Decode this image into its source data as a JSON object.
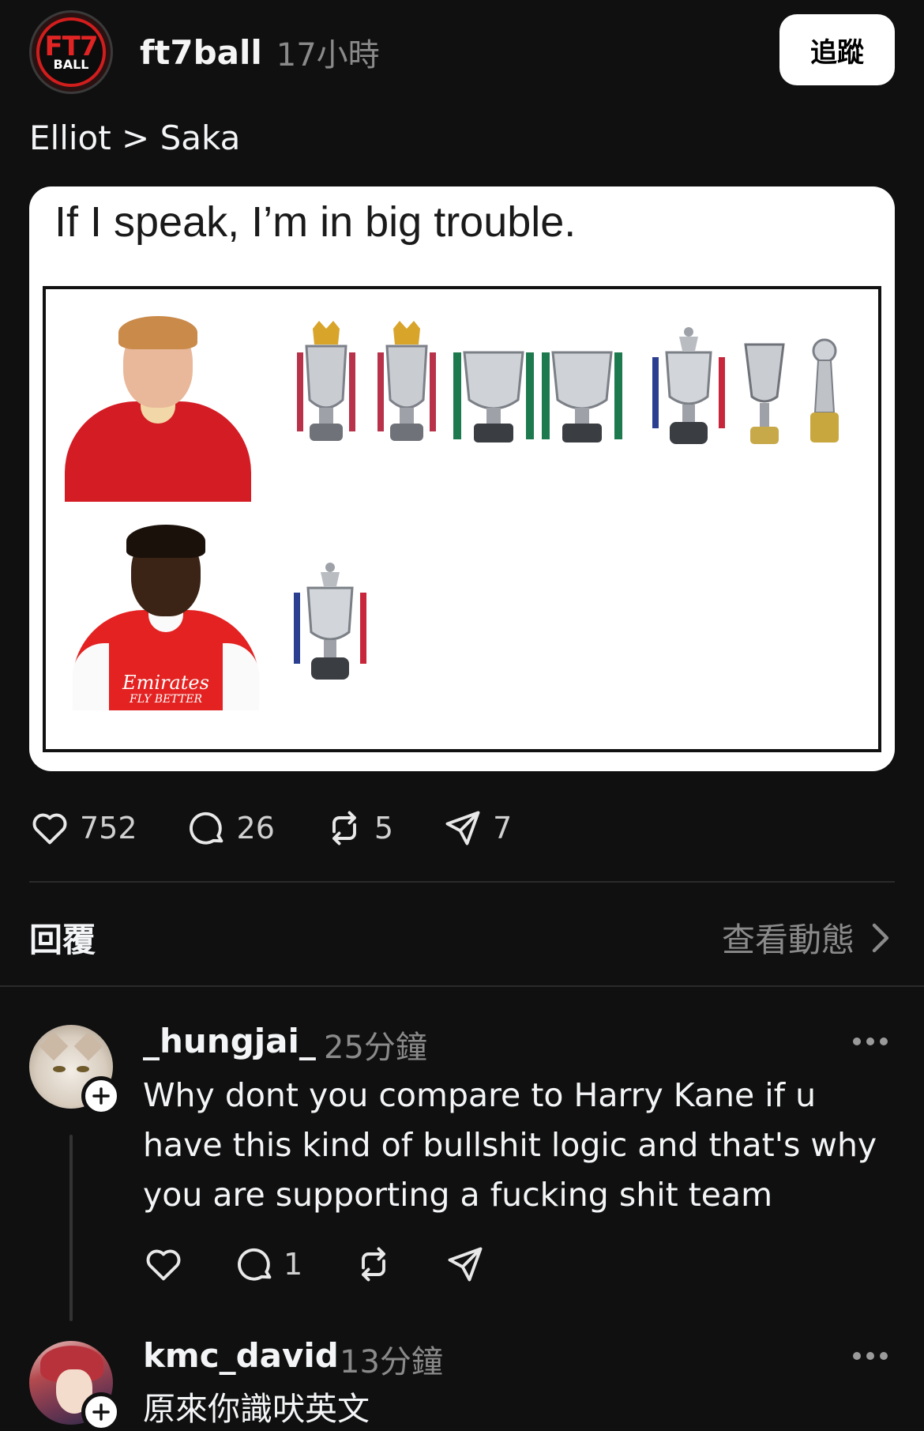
{
  "post": {
    "username": "ft7ball",
    "time": "17小時",
    "follow_label": "追蹤",
    "avatar_logo_top": "FT7",
    "avatar_logo_bottom": "BALL",
    "text": "Elliot > Saka"
  },
  "meme": {
    "caption": "If I speak, I’m in big trouble.",
    "row1_player": "elliott",
    "row1_trophies": [
      "premier-league-trophy",
      "premier-league-trophy",
      "league-cup-trophy",
      "league-cup-trophy",
      "fa-cup-trophy",
      "super-cup-trophy",
      "club-world-cup-trophy"
    ],
    "row2_player": "saka",
    "row2_trophies": [
      "fa-cup-trophy"
    ],
    "saka_sponsor": "Emirates",
    "saka_sponsor_sub": "FLY BETTER"
  },
  "actions": {
    "likes": "752",
    "comments": "26",
    "reposts": "5",
    "shares": "7"
  },
  "replies_section": {
    "heading": "回覆",
    "activity_label": "查看動態"
  },
  "comments": [
    {
      "username": "_hungjai_",
      "time": "25分鐘",
      "text": "Why dont you compare to Harry Kane if u have this kind of bullshit logic and that's why you are supporting a fucking shit team",
      "replies_count": "1"
    },
    {
      "username": "kmc_david",
      "time": "13分鐘",
      "text": "原來你識吠英文"
    }
  ],
  "colors": {
    "background": "#101010",
    "text": "#f3f5f7",
    "muted": "#8a8a8a",
    "divider": "#2b2b2b"
  },
  "icons": [
    "heart-icon",
    "comment-icon",
    "repost-icon",
    "share-icon",
    "chevron-right-icon",
    "plus-icon",
    "more-icon"
  ]
}
